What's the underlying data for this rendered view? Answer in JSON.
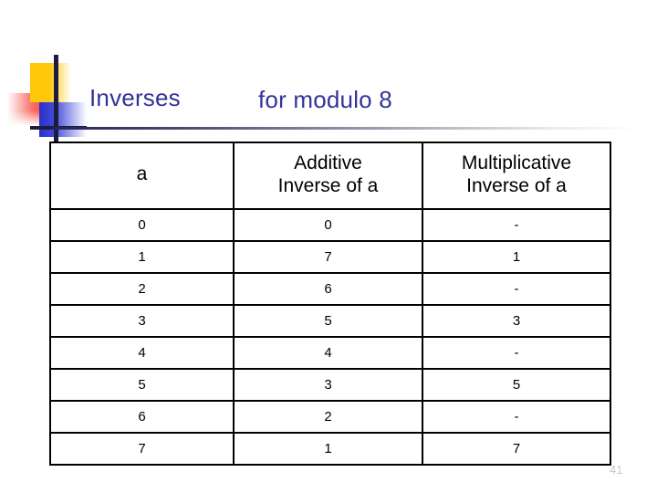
{
  "slide": {
    "title_main": "Inverses",
    "title_sub": "for modulo 8",
    "slide_number": "41",
    "title_color": "#333399",
    "accent_colors": {
      "yellow": "#FFC709",
      "red": "#F03229",
      "blue": "#2A30C8",
      "bar": "#1C1C3C"
    }
  },
  "table": {
    "headers": [
      {
        "line1": "a",
        "line2": ""
      },
      {
        "line1": "Additive",
        "line2": "Inverse of a"
      },
      {
        "line1": "Multiplicative",
        "line2": "Inverse of a"
      }
    ],
    "rows": [
      {
        "a": "0",
        "additive": "0",
        "multiplicative": "-"
      },
      {
        "a": "1",
        "additive": "7",
        "multiplicative": "1"
      },
      {
        "a": "2",
        "additive": "6",
        "multiplicative": "-"
      },
      {
        "a": "3",
        "additive": "5",
        "multiplicative": "3"
      },
      {
        "a": "4",
        "additive": "4",
        "multiplicative": "-"
      },
      {
        "a": "5",
        "additive": "3",
        "multiplicative": "5"
      },
      {
        "a": "6",
        "additive": "2",
        "multiplicative": "-"
      },
      {
        "a": "7",
        "additive": "1",
        "multiplicative": "7"
      }
    ]
  }
}
